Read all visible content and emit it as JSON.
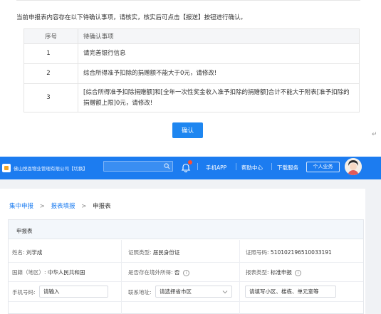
{
  "dialog": {
    "notice": "当前申报表内容存在以下待确认事项，请核实，核实后可点击【报送】按钮进行确认。",
    "table": {
      "headers": [
        "序号",
        "待确认事项"
      ],
      "rows": [
        {
          "no": "1",
          "item": "请完善银行信息"
        },
        {
          "no": "2",
          "item": "综合所得准予扣除的捐赠额不能大于0元，请修改!"
        },
        {
          "no": "3",
          "item": "[综合所得准予扣除捐赠额]和[全年一次性奖金收入准予扣除的捐赠额]合计不能大于附表[准予扣除的捐赠额上限]0元，请修改!"
        }
      ]
    },
    "confirm_label": "确认",
    "return_mark": "↵"
  },
  "header": {
    "company": "佛山悦恩物业管理有限公司【切换】",
    "search_placeholder": "",
    "links": [
      "手机APP",
      "帮助中心",
      "下载服务"
    ],
    "personal_label": "个人业务",
    "colors": {
      "primary": "#1c7cf0",
      "notice_dot": "#ff4d2e"
    }
  },
  "breadcrumb": {
    "items": [
      "集中申报",
      "报表填报",
      "申报表"
    ],
    "separator": ">"
  },
  "form": {
    "section_title": "申报表",
    "name": {
      "label": "姓名:",
      "value": "刘学成"
    },
    "id_type": {
      "label": "证照类型:",
      "value": "居民身份证"
    },
    "id_no": {
      "label": "证照号码:",
      "value": "510102196510033191"
    },
    "nationality": {
      "label": "国籍（地区）:",
      "value": "中华人民共和国"
    },
    "overseas_income": {
      "label": "是否存在境外所得:",
      "value": "否"
    },
    "report_type": {
      "label": "报表类型:",
      "value": "标准申报"
    },
    "phone": {
      "label": "手机号码:",
      "value": "请输入"
    },
    "address": {
      "label": "联系地址:",
      "value": "请选择省市区"
    },
    "address_detail": {
      "value": "请填写小区、楼栋、单元室等"
    }
  }
}
